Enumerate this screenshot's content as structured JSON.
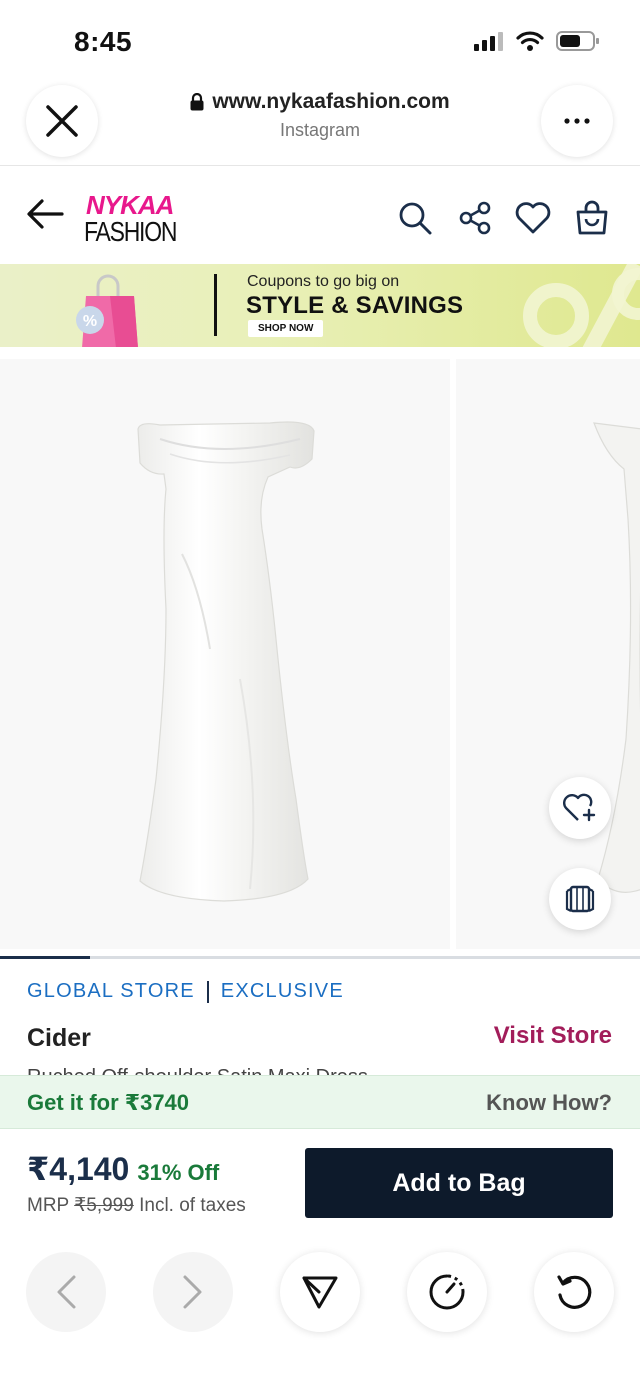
{
  "status_bar": {
    "time": "8:45"
  },
  "url_bar": {
    "url": "www.nykaafashion.com",
    "source": "Instagram"
  },
  "header": {
    "logo_top": "NYKAA",
    "logo_bottom": "FASHION"
  },
  "banner": {
    "line1": "Coupons to go big on",
    "line2": "STYLE & SAVINGS",
    "cta": "SHOP NOW"
  },
  "gallery": {
    "progress": 0.14
  },
  "product": {
    "store_tag": "GLOBAL STORE",
    "exclusive_tag": "EXCLUSIVE",
    "brand": "Cider",
    "visit_store": "Visit Store",
    "title": "Ruched Off-shoulder Satin Maxi Dress"
  },
  "offer": {
    "text": "Get it for ₹3740",
    "link": "Know How?"
  },
  "price": {
    "current": "₹4,140",
    "discount": "31% Off",
    "mrp_label": "MRP",
    "mrp_value": "₹5,999",
    "tax_note": "Incl. of taxes",
    "add_to_bag": "Add to Bag"
  },
  "colors": {
    "accent_pink": "#e8188c",
    "store_blue": "#1b6ec2",
    "visit_store": "#a21d5a",
    "offer_green": "#1a7a3a",
    "button_dark": "#0d1a2b"
  }
}
